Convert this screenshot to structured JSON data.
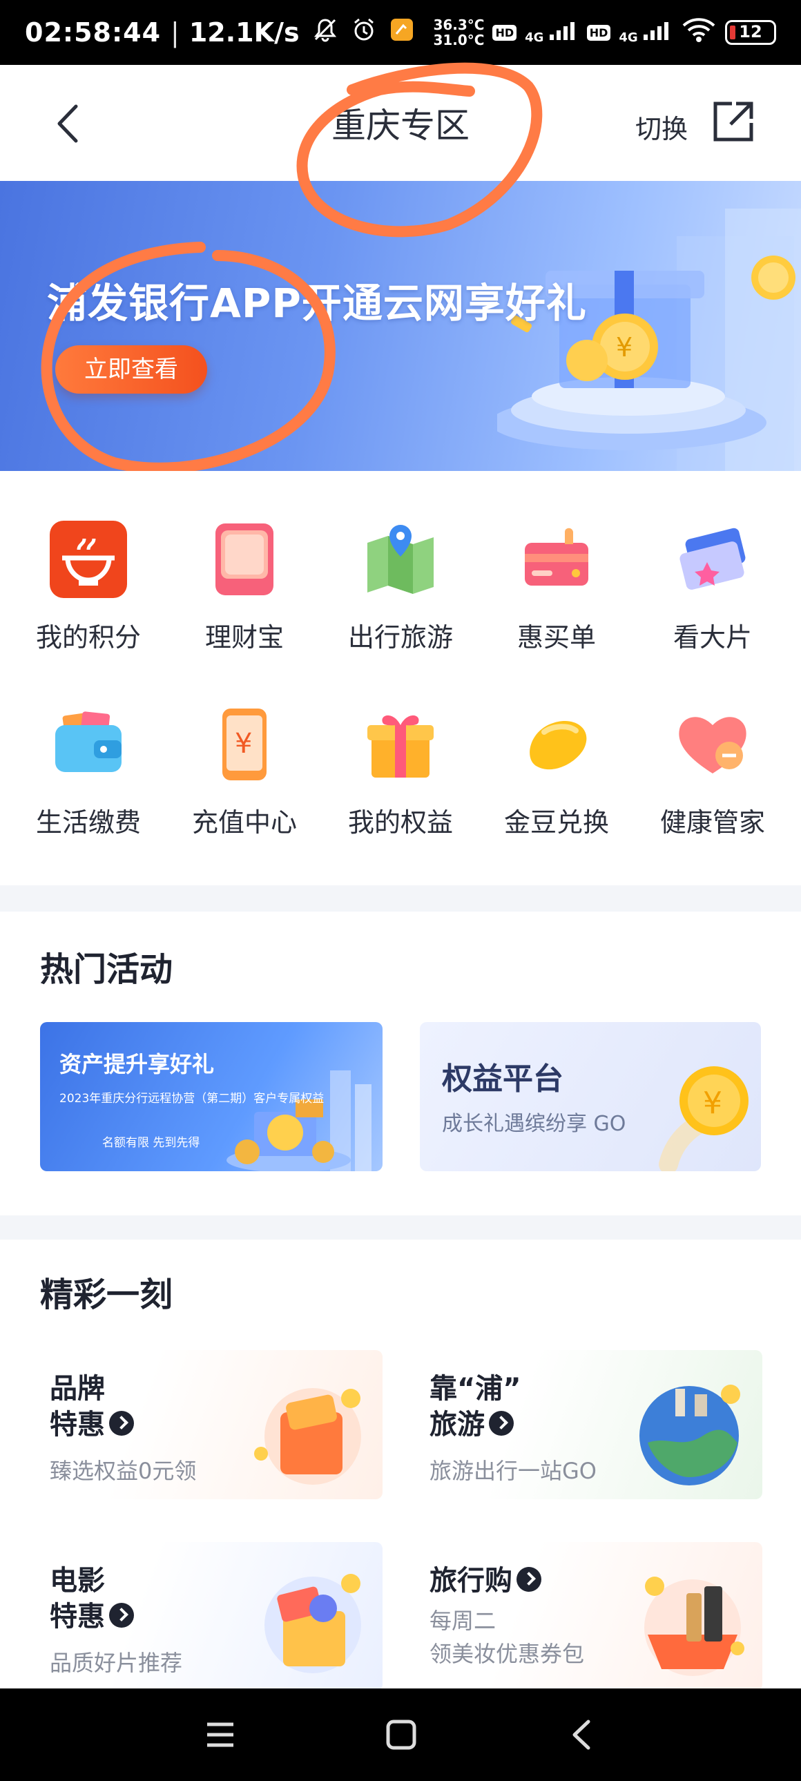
{
  "status_bar": {
    "time": "02:58:44",
    "net_speed": "12.1K/s",
    "temp_top": "36.3°C",
    "temp_bottom": "31.0°C",
    "hd1": "HD",
    "net1": "4G",
    "hd2": "HD",
    "net2": "4G",
    "battery": "12"
  },
  "header": {
    "title": "重庆专区",
    "switch_label": "切换"
  },
  "banner": {
    "promo_text": "浦发银行APP开通云网享好礼",
    "cta_label": "立即查看"
  },
  "grid": {
    "items": [
      {
        "label": "我的积分",
        "icon": "points-icon"
      },
      {
        "label": "理财宝",
        "icon": "wealth-icon"
      },
      {
        "label": "出行旅游",
        "icon": "map-icon"
      },
      {
        "label": "惠买单",
        "icon": "card-icon"
      },
      {
        "label": "看大片",
        "icon": "ticket-icon"
      },
      {
        "label": "生活缴费",
        "icon": "wallet-icon"
      },
      {
        "label": "充值中心",
        "icon": "topup-icon"
      },
      {
        "label": "我的权益",
        "icon": "gift-icon"
      },
      {
        "label": "金豆兑换",
        "icon": "bean-icon"
      },
      {
        "label": "健康管家",
        "icon": "heart-icon"
      }
    ]
  },
  "hot": {
    "title": "热门活动",
    "card1_title": "资产提升享好礼",
    "card1_sub": "2023年重庆分行远程协营（第二期）客户专属权益",
    "card1_note": "名额有限 先到先得",
    "card2_title": "权益平台",
    "card2_sub": "成长礼遇缤纷享 GO"
  },
  "moments": {
    "title": "精彩一刻",
    "cards": [
      {
        "title_l1": "品牌",
        "title_l2": "特惠",
        "sub": "臻选权益0元领"
      },
      {
        "title_l1": "靠“浦”",
        "title_l2": "旅游",
        "sub": "旅游出行一站GO"
      },
      {
        "title_l1": "电影",
        "title_l2": "特惠",
        "sub": "品质好片推荐"
      },
      {
        "title_l1": "旅行购",
        "sub_l1": "每周二",
        "sub_l2": "领美妆优惠券包"
      }
    ]
  },
  "colors": {
    "accent_orange": "#f4511e",
    "banner_blue": "#4a74e0",
    "annotation": "#ff7b45"
  }
}
